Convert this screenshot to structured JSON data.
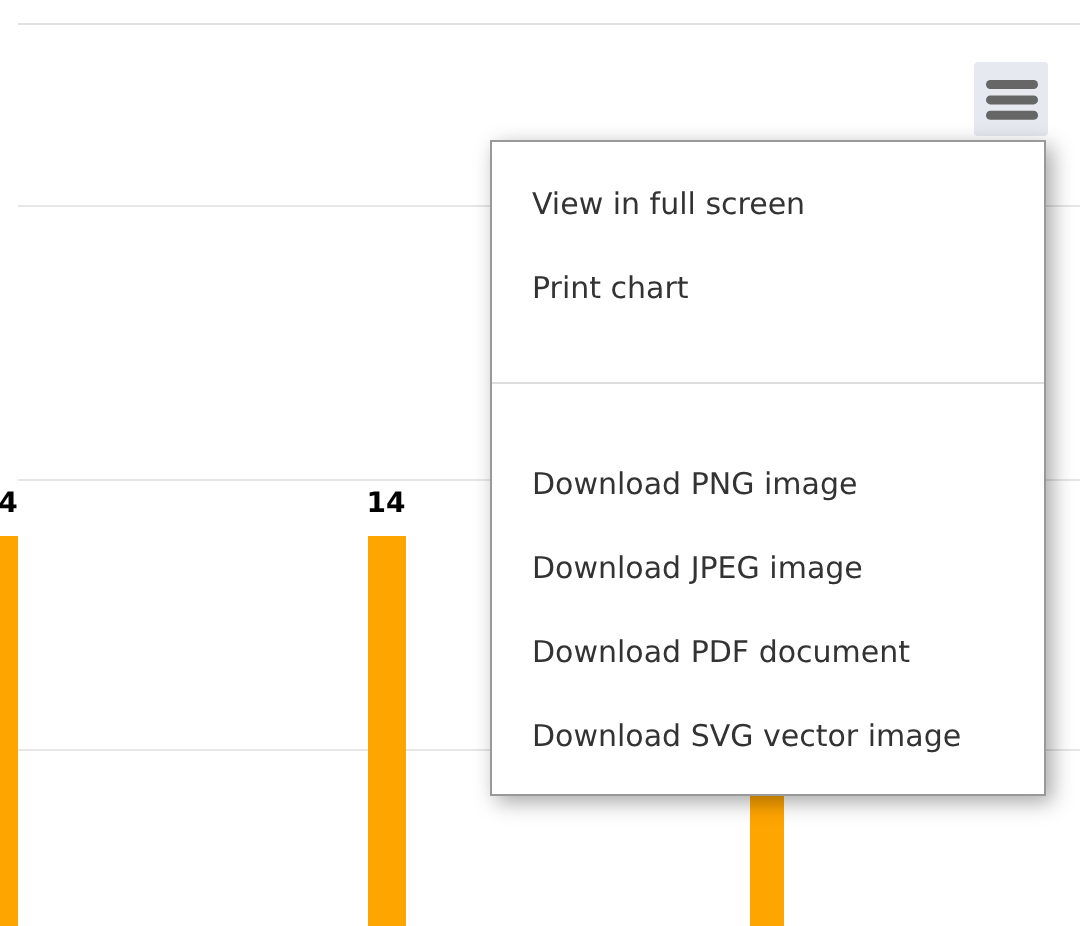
{
  "chart": {
    "bar_labels": [
      "4",
      "14"
    ]
  },
  "menu_button": {
    "expanded": true
  },
  "menu": {
    "items": [
      {
        "label": "View in full screen",
        "kind": "item"
      },
      {
        "label": "Print chart",
        "kind": "item"
      },
      {
        "kind": "separator"
      },
      {
        "label": "Download PNG image",
        "kind": "item"
      },
      {
        "label": "Download JPEG image",
        "kind": "item"
      },
      {
        "label": "Download PDF document",
        "kind": "item"
      },
      {
        "label": "Download SVG vector image",
        "kind": "item"
      }
    ]
  }
}
